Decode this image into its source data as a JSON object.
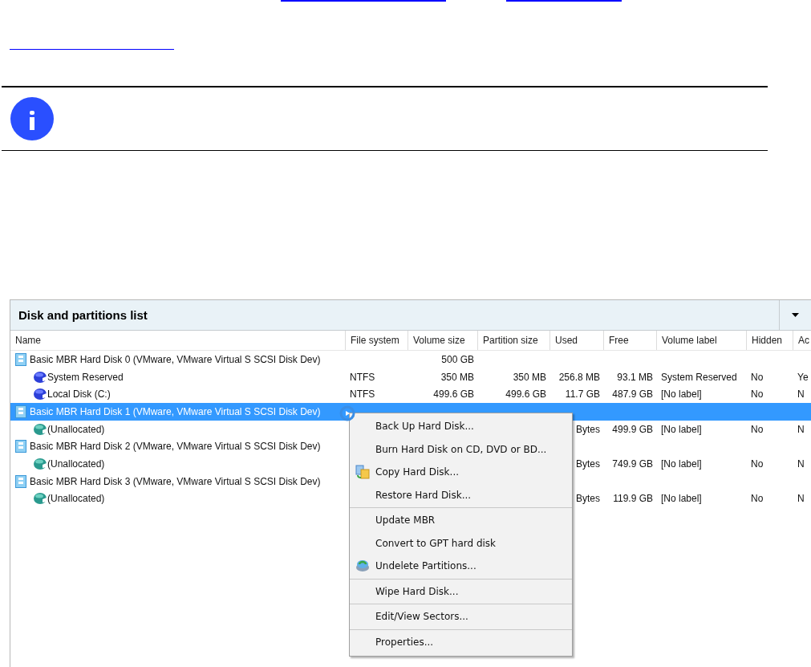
{
  "panel": {
    "title": "Disk and partitions list"
  },
  "table": {
    "columns": [
      "Name",
      "File system",
      "Volume size",
      "Partition size",
      "Used",
      "Free",
      "Volume label",
      "Hidden",
      "Ac"
    ],
    "rows": [
      {
        "kind": "disk",
        "selected": false,
        "cells": [
          "Basic MBR Hard Disk 0 (VMware, VMware Virtual S SCSI Disk Dev)",
          null,
          "500 GB",
          null,
          null,
          null,
          null,
          null,
          null
        ],
        "children": [
          {
            "kind": "partition",
            "selected": false,
            "cells": [
              "System Reserved",
              "NTFS",
              "350 MB",
              "350 MB",
              "256.8 MB",
              "93.1 MB",
              "System Reserved",
              "No",
              "Ye"
            ]
          },
          {
            "kind": "partition",
            "selected": false,
            "cells": [
              "Local Disk (C:)",
              "NTFS",
              "499.6 GB",
              "499.6 GB",
              "11.7 GB",
              "487.9 GB",
              "[No label]",
              "No",
              "N"
            ]
          }
        ]
      },
      {
        "kind": "disk",
        "selected": true,
        "cells": [
          "Basic MBR Hard Disk 1 (VMware, VMware Virtual S SCSI Disk Dev)",
          null,
          null,
          null,
          null,
          null,
          null,
          null,
          null
        ],
        "children": [
          {
            "kind": "unallocated",
            "selected": false,
            "cells": [
              "(Unallocated)",
              null,
              null,
              null,
              "Bytes",
              "499.9 GB",
              "[No label]",
              "No",
              "N"
            ]
          }
        ]
      },
      {
        "kind": "disk",
        "selected": false,
        "cells": [
          "Basic MBR Hard Disk 2 (VMware, VMware Virtual S SCSI Disk Dev)",
          null,
          null,
          null,
          null,
          null,
          null,
          null,
          null
        ],
        "children": [
          {
            "kind": "unallocated",
            "selected": false,
            "cells": [
              "(Unallocated)",
              null,
              null,
              null,
              "Bytes",
              "749.9 GB",
              "[No label]",
              "No",
              "N"
            ]
          }
        ]
      },
      {
        "kind": "disk",
        "selected": false,
        "cells": [
          "Basic MBR Hard Disk 3 (VMware, VMware Virtual S SCSI Disk Dev)",
          null,
          null,
          null,
          null,
          null,
          null,
          null,
          null
        ],
        "children": [
          {
            "kind": "unallocated",
            "selected": false,
            "cells": [
              "(Unallocated)",
              null,
              null,
              null,
              "Bytes",
              "119.9 GB",
              "[No label]",
              "No",
              "N"
            ]
          }
        ]
      }
    ]
  },
  "context_menu": {
    "groups": [
      [
        "Back Up Hard Disk...",
        "Burn Hard Disk on CD, DVD or BD...",
        "Copy Hard Disk...",
        "Restore Hard Disk..."
      ],
      [
        "Update MBR",
        "Convert to GPT hard disk",
        "Undelete Partitions..."
      ],
      [
        "Wipe Hard Disk..."
      ],
      [
        "Edit/View Sectors..."
      ],
      [
        "Properties..."
      ]
    ]
  }
}
